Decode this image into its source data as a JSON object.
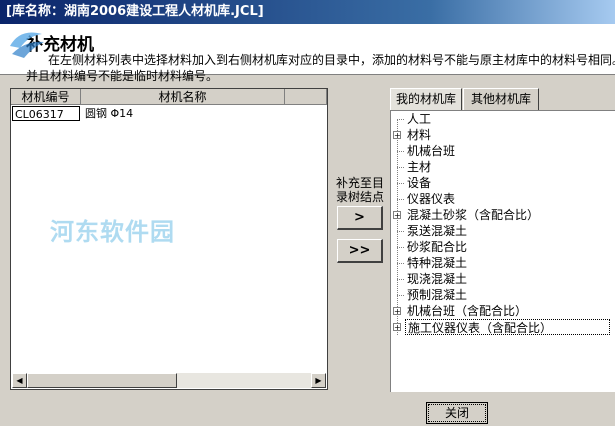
{
  "window": {
    "title": "[库名称：湖南2006建设工程人材机库.JCL]"
  },
  "header": {
    "section_title": "补充材机",
    "desc_line1": "在左侧材料列表中选择材料加入到右侧材机库对应的目录中，添加的材料号不能与原主材库中的材料号相同。",
    "desc_line2": "并且材料编号不能是临时材料编号。"
  },
  "watermark": {
    "text": "河东软件园"
  },
  "table": {
    "columns": [
      "材机编号",
      "材机名称"
    ],
    "rows": [
      {
        "code": "CL06317",
        "name": "圆钢  Φ14"
      }
    ]
  },
  "middle": {
    "label": "补充至目录树结点",
    "add_one": ">",
    "add_all": ">>"
  },
  "tabs": [
    "我的材机库",
    "其他材机库"
  ],
  "tree": {
    "items": [
      {
        "label": "人工",
        "expandable": false
      },
      {
        "label": "材料",
        "expandable": true
      },
      {
        "label": "机械台班",
        "expandable": false
      },
      {
        "label": "主材",
        "expandable": false
      },
      {
        "label": "设备",
        "expandable": false
      },
      {
        "label": "仪器仪表",
        "expandable": false
      },
      {
        "label": "混凝土砂浆（含配合比）",
        "expandable": true
      },
      {
        "label": "泵送混凝土",
        "expandable": false
      },
      {
        "label": "砂浆配合比",
        "expandable": false
      },
      {
        "label": "特种混凝土",
        "expandable": false
      },
      {
        "label": "现浇混凝土",
        "expandable": false
      },
      {
        "label": "预制混凝土",
        "expandable": false
      },
      {
        "label": "机械台班（含配合比）",
        "expandable": true
      },
      {
        "label": "施工仪器仪表（含配合比）",
        "expandable": true
      }
    ]
  },
  "footer": {
    "close_label": "关闭"
  }
}
